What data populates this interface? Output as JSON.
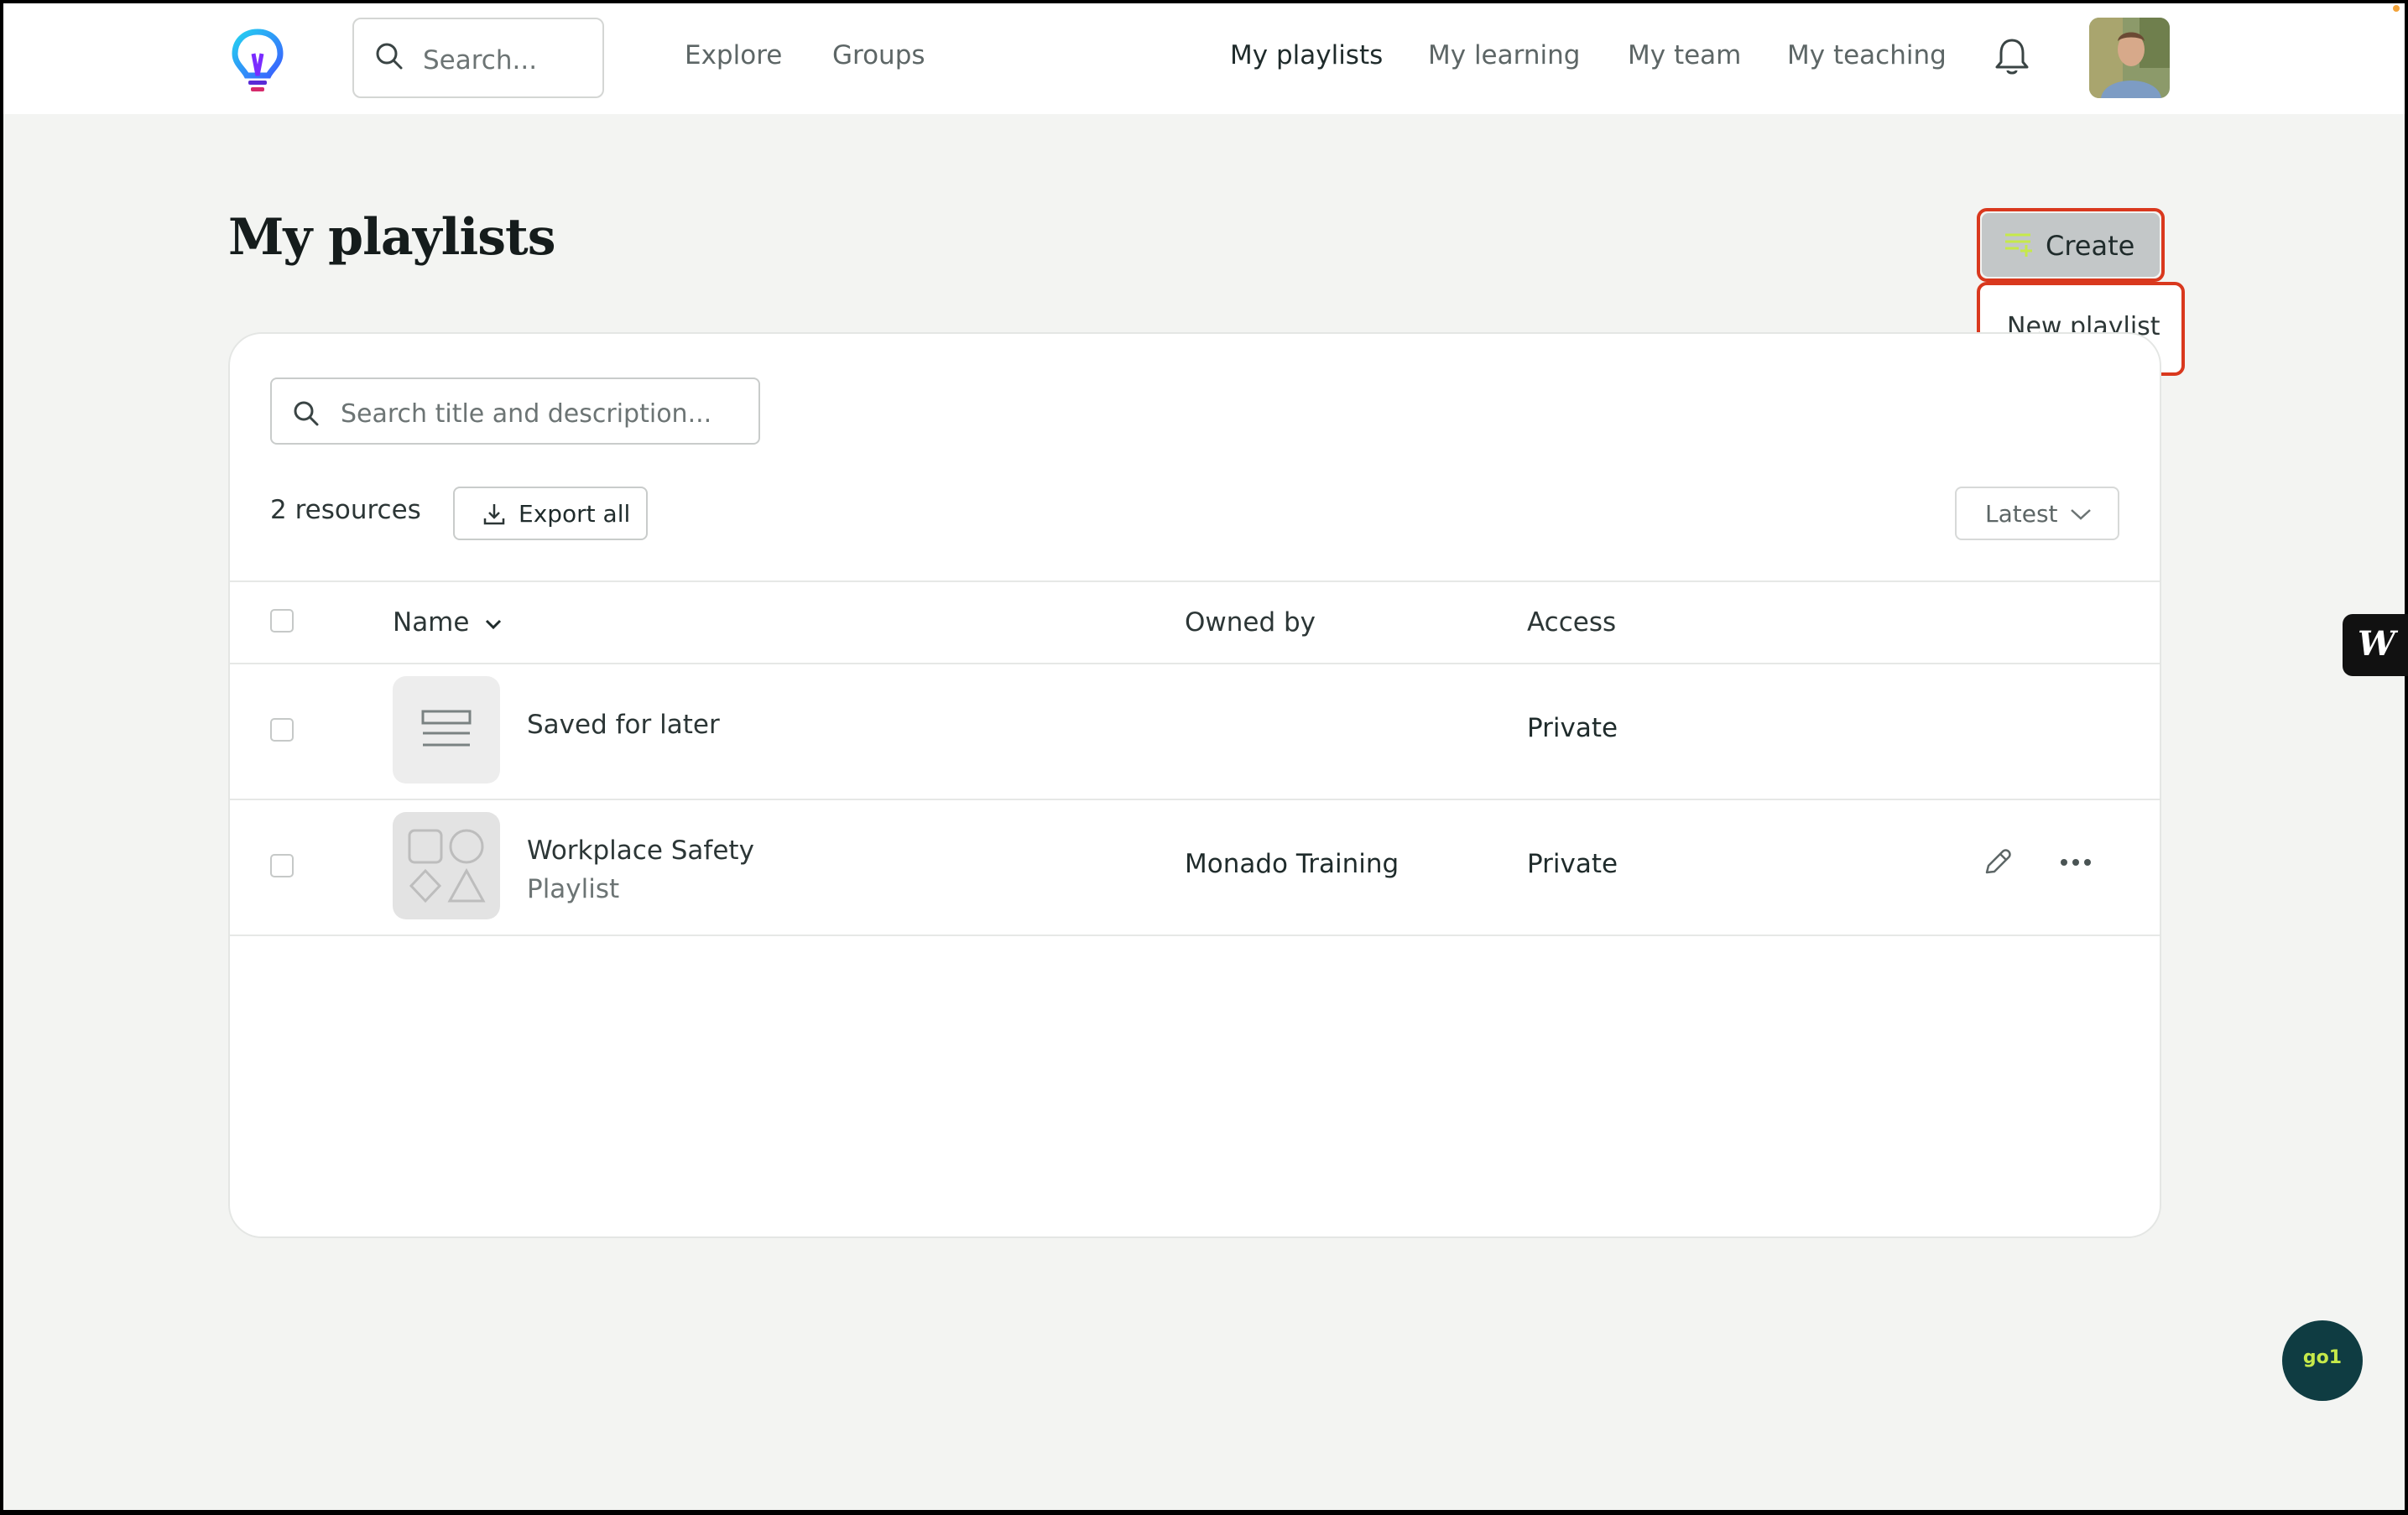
{
  "nav": {
    "search_placeholder": "Search...",
    "links": [
      "Explore",
      "Groups"
    ],
    "right_links": [
      "My playlists",
      "My learning",
      "My team",
      "My teaching"
    ],
    "active": "My playlists"
  },
  "page": {
    "title": "My playlists",
    "create_label": "Create",
    "dropdown": [
      "New playlist"
    ]
  },
  "table": {
    "search_placeholder": "Search title and description...",
    "count": "2 resources",
    "export_label": "Export all",
    "sort_label": "Latest",
    "columns": [
      "Name",
      "Owned by",
      "Access"
    ],
    "rows": [
      {
        "title": "Saved for later",
        "subtitle": "",
        "owner": "",
        "access": "Private"
      },
      {
        "title": "Workplace Safety",
        "subtitle": "Playlist",
        "owner": "Monado Training",
        "access": "Private"
      }
    ]
  },
  "widgets": {
    "go1_label": "go1",
    "w_label": "W"
  },
  "colors": {
    "highlight": "#d9381e",
    "create_bg": "#c3c7c8",
    "go1_bg": "#0f3c42",
    "go1_text": "#c6e94a"
  }
}
